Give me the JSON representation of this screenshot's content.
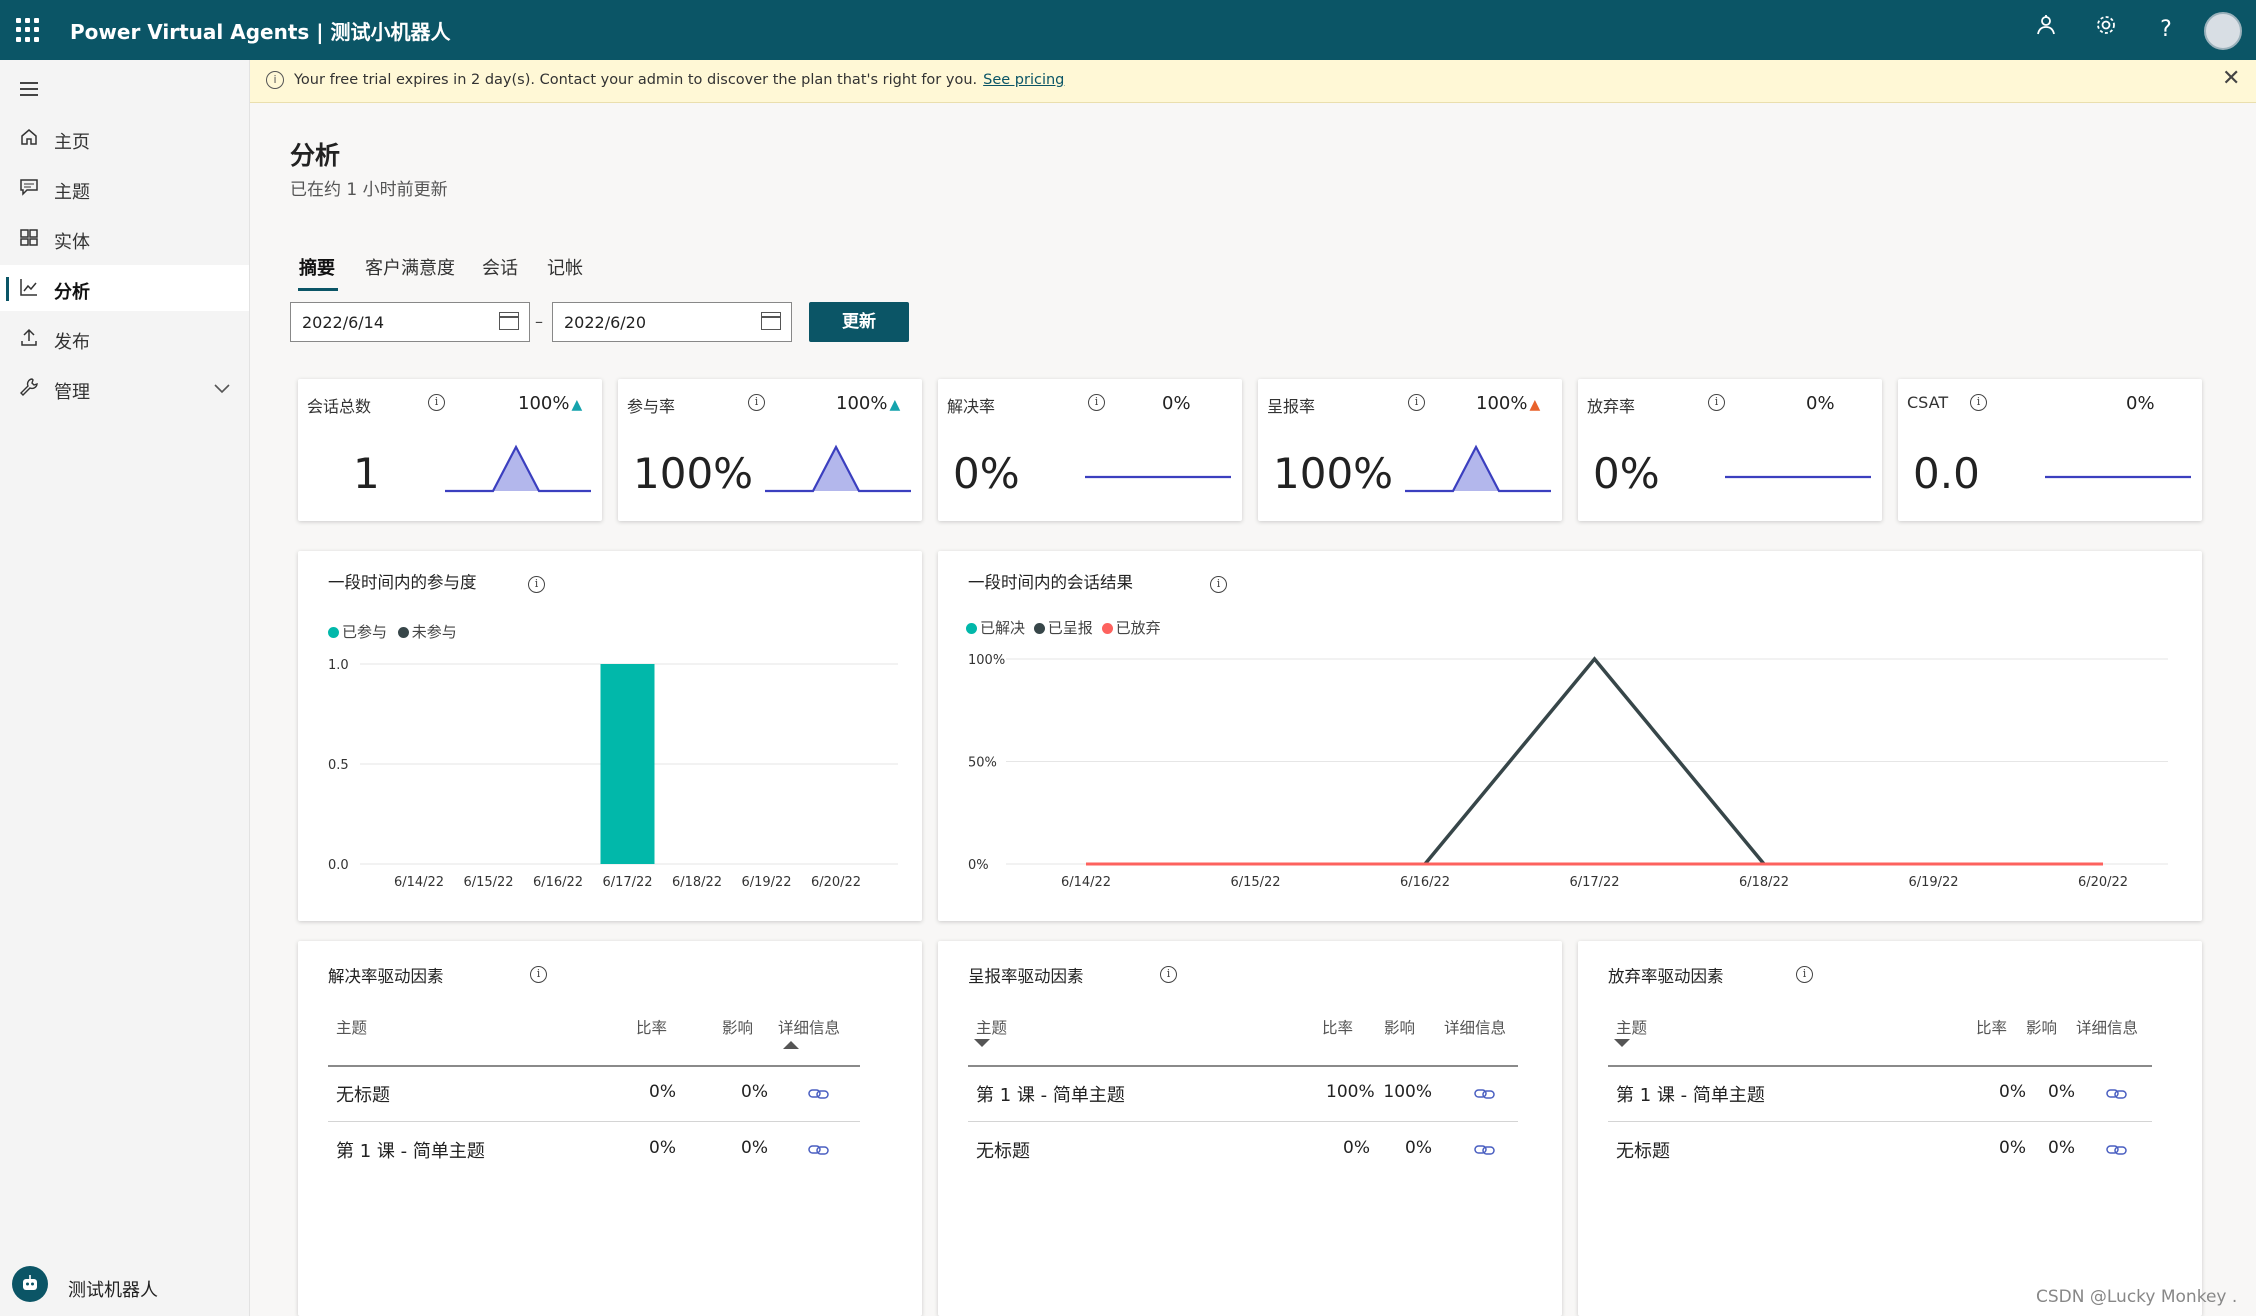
{
  "app": {
    "title": "Power Virtual Agents | 测试小机器人"
  },
  "topbar": {
    "icons": [
      "waffle-icon",
      "bot-person-icon",
      "gear-icon",
      "help-icon",
      "user-avatar"
    ]
  },
  "sidebar": {
    "items": [
      {
        "label": "主页",
        "icon": "home-icon"
      },
      {
        "label": "主题",
        "icon": "chat-icon"
      },
      {
        "label": "实体",
        "icon": "entity-icon"
      },
      {
        "label": "分析",
        "icon": "chart-icon",
        "active": true
      },
      {
        "label": "发布",
        "icon": "upload-icon"
      },
      {
        "label": "管理",
        "icon": "wrench-icon"
      }
    ],
    "bot_name": "测试机器人"
  },
  "banner": {
    "message": "Your free trial expires in 2 day(s). Contact your admin to discover the plan that's right for you.",
    "link": "See pricing"
  },
  "page": {
    "title": "分析",
    "subtitle": "已在约 1 小时前更新"
  },
  "tabs": [
    "摘要",
    "客户满意度",
    "会话",
    "记帐"
  ],
  "dates": {
    "start": "2022/6/14",
    "sep": "–",
    "end": "2022/6/20"
  },
  "update_button": "更新",
  "kpis": [
    {
      "label": "会话总数",
      "delta": "100%",
      "trend": "up",
      "trend_color": "#15a3ad",
      "value": "1",
      "spark": "peak"
    },
    {
      "label": "参与率",
      "delta": "100%",
      "trend": "up",
      "trend_color": "#15a3ad",
      "value": "100%",
      "spark": "peak"
    },
    {
      "label": "解决率",
      "delta": "0%",
      "trend": "none",
      "value": "0%",
      "spark": "flat"
    },
    {
      "label": "呈报率",
      "delta": "100%",
      "trend": "up",
      "trend_color": "#e8622c",
      "value": "100%",
      "spark": "peak"
    },
    {
      "label": "放弃率",
      "delta": "0%",
      "trend": "none",
      "value": "0%",
      "spark": "flat"
    },
    {
      "label": "CSAT",
      "delta": "0%",
      "trend": "none",
      "value": "0.0",
      "spark": "flat"
    }
  ],
  "chart_data": [
    {
      "type": "bar",
      "title": "一段时间内的参与度",
      "categories": [
        "6/14/22",
        "6/15/22",
        "6/16/22",
        "6/17/22",
        "6/18/22",
        "6/19/22",
        "6/20/22"
      ],
      "series": [
        {
          "name": "已参与",
          "color": "#01b8aa",
          "values": [
            0,
            0,
            0,
            1,
            0,
            0,
            0
          ]
        },
        {
          "name": "未参与",
          "color": "#374649",
          "values": [
            0,
            0,
            0,
            0,
            0,
            0,
            0
          ]
        }
      ],
      "yticks": [
        "1.0",
        "0.5",
        "0.0"
      ],
      "ylim": [
        0,
        1
      ],
      "grid": true
    },
    {
      "type": "line",
      "title": "一段时间内的会话结果",
      "categories": [
        "6/14/22",
        "6/15/22",
        "6/16/22",
        "6/17/22",
        "6/18/22",
        "6/19/22",
        "6/20/22"
      ],
      "series": [
        {
          "name": "已解决",
          "color": "#01b8aa",
          "values": [
            0,
            0,
            0,
            0,
            0,
            0,
            0
          ]
        },
        {
          "name": "已呈报",
          "color": "#374649",
          "values": [
            null,
            null,
            0,
            100,
            0,
            null,
            null
          ]
        },
        {
          "name": "已放弃",
          "color": "#fd625e",
          "values": [
            0,
            0,
            0,
            0,
            0,
            0,
            0
          ]
        }
      ],
      "yticks": [
        "100%",
        "50%",
        "0%"
      ],
      "ylim": [
        0,
        100
      ],
      "grid": true
    }
  ],
  "drivers": [
    {
      "title": "解决率驱动因素",
      "headers": {
        "topic": "主题",
        "rate": "比率",
        "impact": "影响",
        "detail": "详细信息"
      },
      "rows": [
        {
          "topic": "无标题",
          "rate": "0%",
          "impact": "0%"
        },
        {
          "topic": "第 1 课 - 简单主题",
          "rate": "0%",
          "impact": "0%"
        }
      ]
    },
    {
      "title": "呈报率驱动因素",
      "headers": {
        "topic": "主题",
        "rate": "比率",
        "impact": "影响",
        "detail": "详细信息"
      },
      "rows": [
        {
          "topic": "第 1 课 - 简单主题",
          "rate": "100%",
          "impact": "100%"
        },
        {
          "topic": "无标题",
          "rate": "0%",
          "impact": "0%"
        }
      ]
    },
    {
      "title": "放弃率驱动因素",
      "headers": {
        "topic": "主题",
        "rate": "比率",
        "impact": "影响",
        "detail": "详细信息"
      },
      "rows": [
        {
          "topic": "第 1 课 - 简单主题",
          "rate": "0%",
          "impact": "0%"
        },
        {
          "topic": "无标题",
          "rate": "0%",
          "impact": "0%"
        }
      ]
    }
  ],
  "watermark": "CSDN @Lucky Monkey ."
}
